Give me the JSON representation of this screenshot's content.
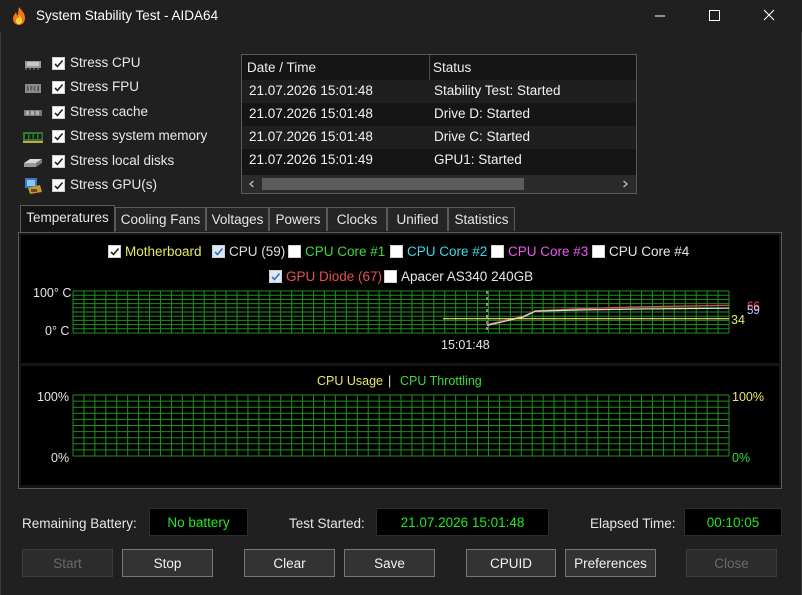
{
  "window": {
    "title": "System Stability Test - AIDA64",
    "app_icon": "flame-icon",
    "controls": [
      "minimize-icon",
      "maximize-icon",
      "close-icon"
    ]
  },
  "stress": [
    {
      "label": "Stress CPU",
      "checked": true,
      "icon": "cpu-chip-icon"
    },
    {
      "label": "Stress FPU",
      "checked": true,
      "icon": "fpu-chip-icon"
    },
    {
      "label": "Stress cache",
      "checked": true,
      "icon": "cache-chip-icon"
    },
    {
      "label": "Stress system memory",
      "checked": true,
      "icon": "memory-module-icon"
    },
    {
      "label": "Stress local disks",
      "checked": true,
      "icon": "disk-drive-icon"
    },
    {
      "label": "Stress GPU(s)",
      "checked": true,
      "icon": "gpu-card-icon"
    }
  ],
  "log": {
    "columns": [
      "Date / Time",
      "Status"
    ],
    "rows": [
      [
        "21.07.2026 15:01:48",
        "Stability Test: Started"
      ],
      [
        "21.07.2026 15:01:48",
        "Drive D: Started"
      ],
      [
        "21.07.2026 15:01:48",
        "Drive C: Started"
      ],
      [
        "21.07.2026 15:01:49",
        "GPU1: Started"
      ]
    ]
  },
  "tabs": [
    "Temperatures",
    "Cooling Fans",
    "Voltages",
    "Powers",
    "Clocks",
    "Unified",
    "Statistics"
  ],
  "active_tab": "Temperatures",
  "temp_legend": [
    {
      "label": "Motherboard",
      "checked": true,
      "color": "#e8e868"
    },
    {
      "label": "CPU (59)",
      "checked": true,
      "color": "#dcdcdc"
    },
    {
      "label": "CPU Core #1",
      "checked": false,
      "color": "#3cdc3c"
    },
    {
      "label": "CPU Core #2",
      "checked": false,
      "color": "#3cd8e8"
    },
    {
      "label": "CPU Core #3",
      "checked": false,
      "color": "#e85ce8"
    },
    {
      "label": "CPU Core #4",
      "checked": false,
      "color": "#e6e6e6"
    },
    {
      "label": "GPU Diode (67)",
      "checked": true,
      "color": "#e85050"
    },
    {
      "label": "Apacer AS340 240GB",
      "checked": false,
      "color": "#e6e6e6"
    }
  ],
  "temp_chart": {
    "y_max_label": "100° C",
    "y_min_label": "0° C",
    "time_label": "15:01:48",
    "end_values": {
      "gpu": "66",
      "cpu": "59",
      "motherboard": "34"
    },
    "colors": {
      "grid": "#1f8f1f",
      "gpu": "#e85050",
      "cpu": "#dcdcdc",
      "motherboard": "#e8e868",
      "cpu_blue": "#6a8ce8"
    }
  },
  "chart_data": [
    {
      "type": "line",
      "title": "",
      "ylim": [
        0,
        100
      ],
      "y_ticks": [
        "0° C",
        "100° C"
      ],
      "x_marker": "15:01:48",
      "series": [
        {
          "name": "GPU Diode (67)",
          "x": [
            0,
            0.15,
            0.2,
            0.4,
            0.6,
            0.8,
            1.0
          ],
          "values": [
            20,
            40,
            53,
            58,
            62,
            64,
            66
          ]
        },
        {
          "name": "CPU (59)",
          "x": [
            0,
            0.15,
            0.2,
            0.4,
            0.6,
            0.8,
            1.0
          ],
          "values": [
            18,
            38,
            52,
            55,
            57,
            58,
            59
          ]
        },
        {
          "name": "Motherboard",
          "x": [
            0,
            1.0
          ],
          "values": [
            34,
            34
          ]
        }
      ]
    },
    {
      "type": "line",
      "title": "CPU Usage | CPU Throttling",
      "ylim": [
        0,
        100
      ],
      "y_ticks": [
        "0%",
        "100%"
      ],
      "series": []
    }
  ],
  "cpu_chart": {
    "legend_usage": "CPU Usage",
    "legend_sep": "|",
    "legend_throttle": "CPU Throttling",
    "y_max_label": "100%",
    "y_min_label": "0%",
    "y_max_right": "100%",
    "y_min_right": "0%",
    "colors": {
      "usage": "#e8e868",
      "throttle": "#3cdc3c"
    }
  },
  "info": {
    "battery_label": "Remaining Battery:",
    "battery_value": "No battery",
    "started_label": "Test Started:",
    "started_value": "21.07.2026 15:01:48",
    "elapsed_label": "Elapsed Time:",
    "elapsed_value": "00:10:05"
  },
  "buttons": {
    "start": "Start",
    "stop": "Stop",
    "clear": "Clear",
    "save": "Save",
    "cpuid": "CPUID",
    "preferences": "Preferences",
    "close": "Close"
  }
}
